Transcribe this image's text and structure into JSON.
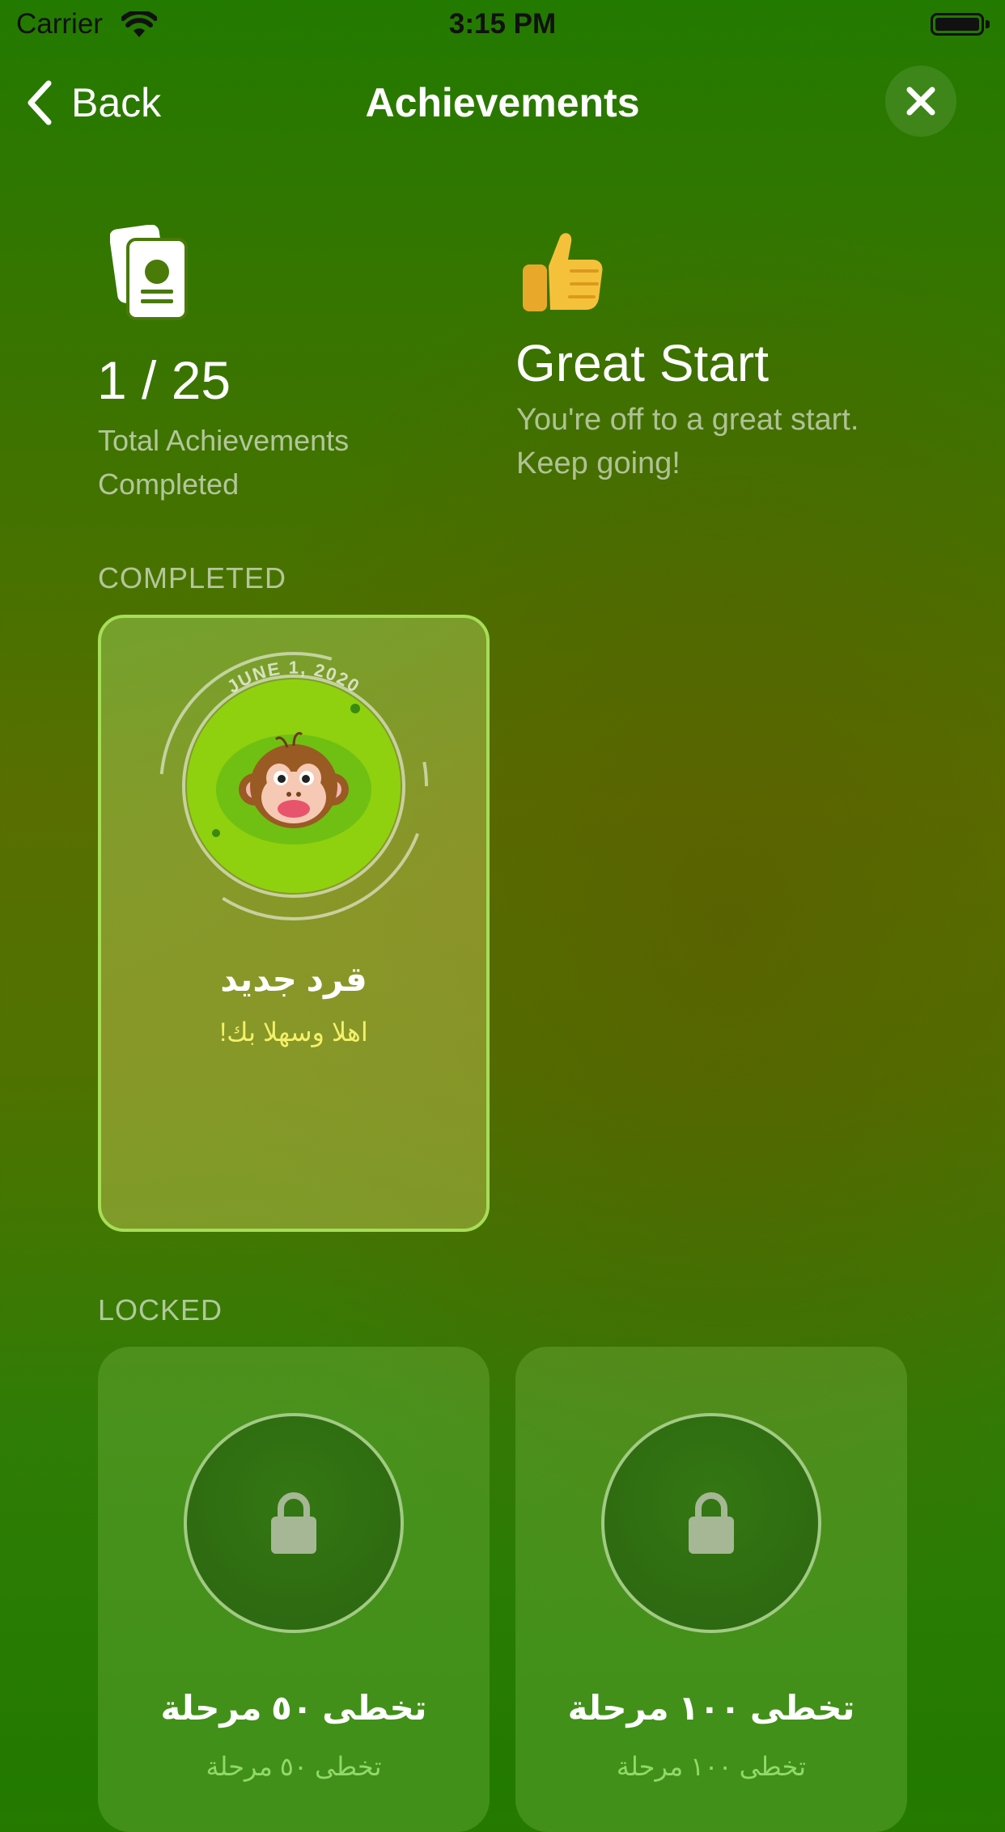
{
  "status_bar": {
    "carrier": "Carrier",
    "time": "3:15 PM"
  },
  "nav": {
    "back_label": "Back",
    "title": "Achievements"
  },
  "stats": {
    "count": "1 / 25",
    "count_label": "Total Achievements Completed",
    "highlight_title": "Great Start",
    "highlight_description": "You're off to a great start. Keep going!"
  },
  "sections": {
    "completed_label": "COMPLETED",
    "locked_label": "LOCKED"
  },
  "completed": [
    {
      "date": "JUNE 1, 2020",
      "title": "قرد جديد",
      "subtitle": "اهلا وسهلا بك!",
      "icon": "monkey-icon"
    }
  ],
  "locked": [
    {
      "title": "تخطى ٥٠ مرحلة",
      "subtitle": "تخطى ٥٠ مرحلة",
      "icon": "lock-icon"
    },
    {
      "title": "تخطى ١٠٠ مرحلة",
      "subtitle": "تخطى ١٠٠ مرحلة",
      "icon": "lock-icon"
    }
  ],
  "colors": {
    "background_top": "#237a00",
    "background_mid": "#586f00",
    "completed_border": "#a6de57",
    "completed_subtitle": "#f4f06a",
    "badge_green": "#8fd10f"
  }
}
